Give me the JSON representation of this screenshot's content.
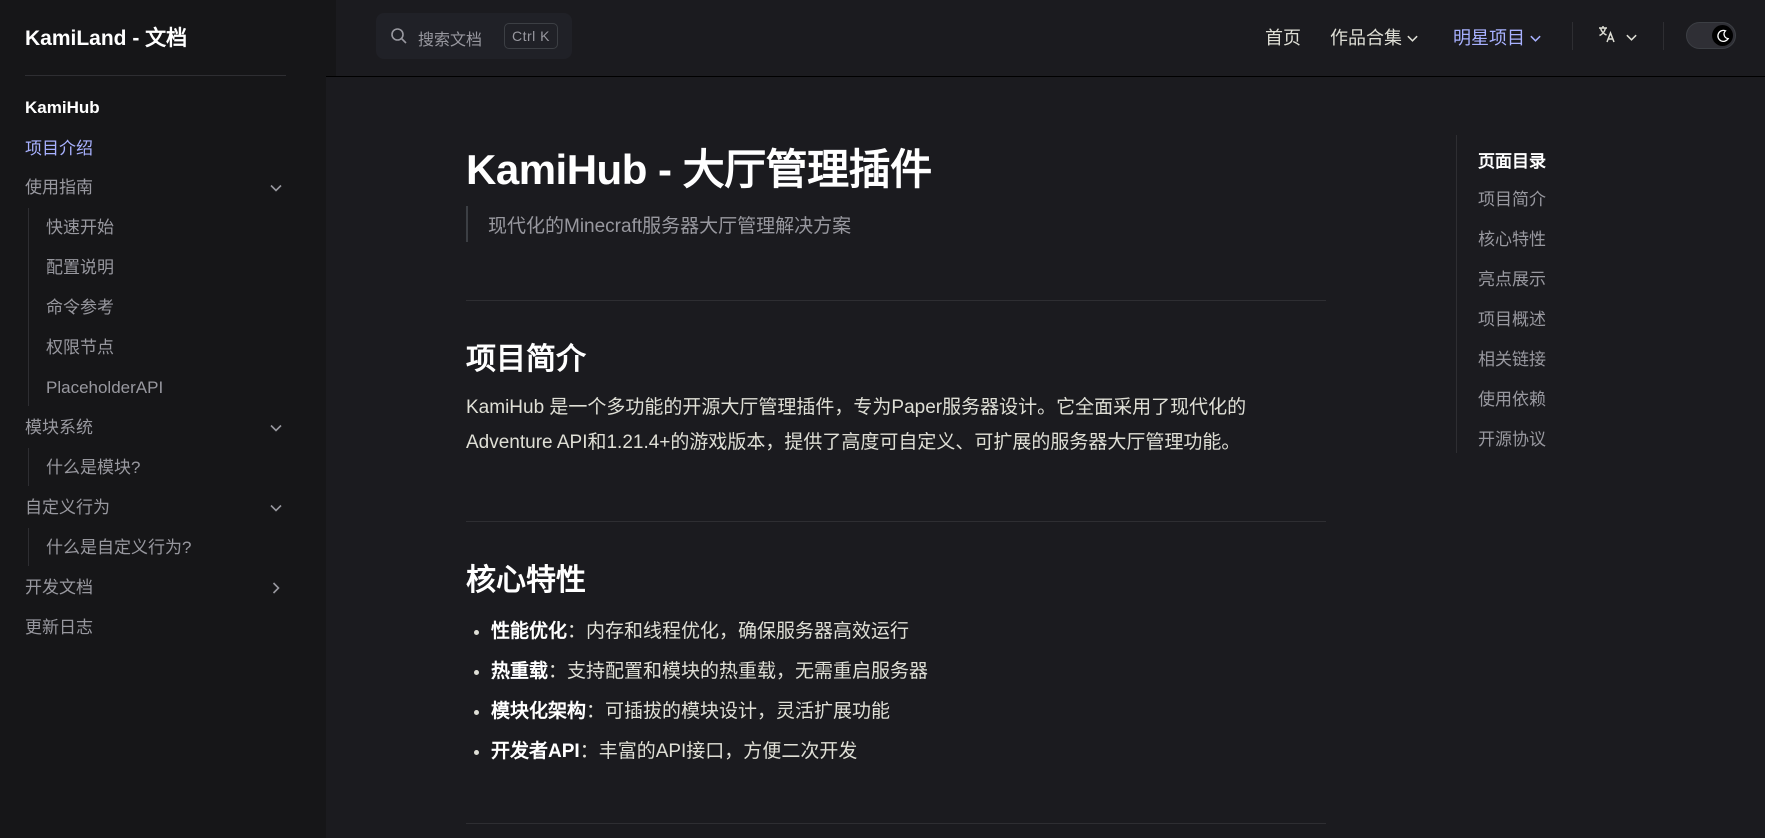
{
  "site": {
    "title": "KamiLand - 文档"
  },
  "search": {
    "placeholder": "搜索文档",
    "shortcut": "Ctrl K"
  },
  "nav": {
    "home": "首页",
    "works": "作品合集",
    "star": "明星项目",
    "accent_color": "#a8b1ff"
  },
  "sidebar": {
    "group_title": "KamiHub",
    "items": [
      {
        "label": "项目介绍"
      },
      {
        "label": "使用指南"
      },
      {
        "label": "快速开始"
      },
      {
        "label": "配置说明"
      },
      {
        "label": "命令参考"
      },
      {
        "label": "权限节点"
      },
      {
        "label": "PlaceholderAPI"
      },
      {
        "label": "模块系统"
      },
      {
        "label": "什么是模块?"
      },
      {
        "label": "自定义行为"
      },
      {
        "label": "什么是自定义行为?"
      },
      {
        "label": "开发文档"
      },
      {
        "label": "更新日志"
      }
    ]
  },
  "page": {
    "title": "KamiHub - 大厅管理插件",
    "subtitle": "现代化的Minecraft服务器大厅管理解决方案",
    "section1": {
      "heading": "项目简介",
      "line1": "KamiHub 是一个多功能的开源大厅管理插件，专为Paper服务器设计。它全面采用了现代化的",
      "line2": "Adventure API和1.21.4+的游戏版本，提供了高度可自定义、可扩展的服务器大厅管理功能。"
    },
    "section2": {
      "heading": "核心特性",
      "features": [
        {
          "name": "性能优化",
          "desc": "：内存和线程优化，确保服务器高效运行"
        },
        {
          "name": "热重载",
          "desc": "：支持配置和模块的热重载，无需重启服务器"
        },
        {
          "name": "模块化架构",
          "desc": "：可插拔的模块设计，灵活扩展功能"
        },
        {
          "name": "开发者API",
          "desc": "：丰富的API接口，方便二次开发"
        }
      ]
    }
  },
  "outline": {
    "title": "页面目录",
    "items": [
      "项目简介",
      "核心特性",
      "亮点展示",
      "项目概述",
      "相关链接",
      "使用依赖",
      "开源协议"
    ]
  }
}
